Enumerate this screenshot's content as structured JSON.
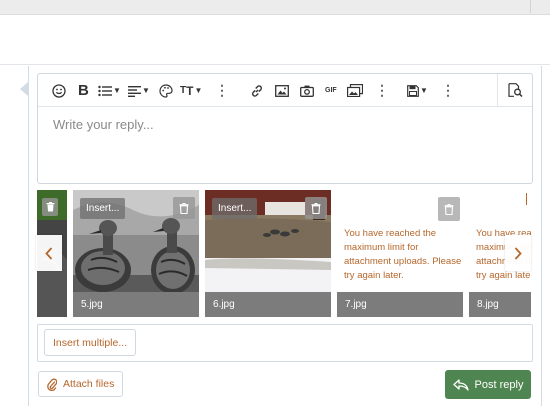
{
  "editor": {
    "placeholder": "Write your reply...",
    "toolbar": [
      {
        "icon": "smiley-icon",
        "label": "Smilies"
      },
      {
        "icon": "bold-icon",
        "label": "B"
      },
      {
        "icon": "list-icon",
        "label": "List"
      },
      {
        "icon": "align-icon",
        "label": "Align"
      },
      {
        "icon": "palette-icon",
        "label": "Color"
      },
      {
        "icon": "text-size-icon",
        "label": "Size"
      },
      {
        "icon": "more-icon",
        "label": "More"
      },
      {
        "icon": "link-icon",
        "label": "Link"
      },
      {
        "icon": "image-icon",
        "label": "Image"
      },
      {
        "icon": "camera-icon",
        "label": "Media"
      },
      {
        "icon": "gif-icon",
        "label": "GIF"
      },
      {
        "icon": "gallery-icon",
        "label": "Gallery"
      },
      {
        "icon": "more-icon",
        "label": "More"
      },
      {
        "icon": "save-icon",
        "label": "Drafts"
      },
      {
        "icon": "more-icon",
        "label": "More"
      },
      {
        "icon": "preview-icon",
        "label": "Preview"
      }
    ],
    "more_glyph": "⋮",
    "gif_text": "GIF"
  },
  "attachments": {
    "items": [
      {
        "filename": "",
        "insert_label": "",
        "has_image": true
      },
      {
        "filename": "5.jpg",
        "insert_label": "Insert...",
        "has_image": true
      },
      {
        "filename": "6.jpg",
        "insert_label": "Insert...",
        "has_image": true
      },
      {
        "filename": "7.jpg",
        "insert_label": "",
        "has_image": false,
        "message": "You have reached the maximum limit for attachment uploads. Please try again later."
      },
      {
        "filename": "8.jpg",
        "insert_label": "",
        "has_image": false,
        "message": "You have reached the maximum limit for attachment uploads. Please try again later."
      }
    ],
    "prev_glyph": "‹",
    "next_glyph": "›"
  },
  "actions": {
    "insert_multiple": "Insert multiple...",
    "attach_files": "Attach files",
    "post_reply": "Post reply"
  },
  "colors": {
    "accent": "#b5672c",
    "post_button": "#4f8550",
    "border": "#d3dbe4"
  }
}
